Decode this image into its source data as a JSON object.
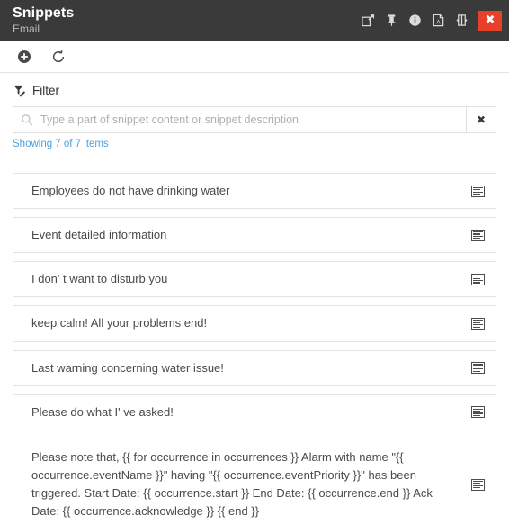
{
  "titlebar": {
    "title": "Snippets",
    "subtitle": "Email",
    "actions": [
      {
        "name": "popout-icon",
        "label": "Open in new window"
      },
      {
        "name": "pin-icon",
        "label": "Pin"
      },
      {
        "name": "info-icon",
        "label": "Info"
      },
      {
        "name": "pdf-icon",
        "label": "Export PDF"
      },
      {
        "name": "dock-icon",
        "label": "Dock panel"
      }
    ],
    "close_label": "✖"
  },
  "toolbar": {
    "add_label": "Add",
    "refresh_label": "Refresh"
  },
  "filter": {
    "label": "Filter",
    "search_value": "",
    "search_placeholder": "Type a part of snippet content or snippet description",
    "clear_label": "✖",
    "showing_text": "Showing 7 of 7 items"
  },
  "snippets": [
    {
      "text": "Employees do not have drinking water"
    },
    {
      "text": "Event detailed information"
    },
    {
      "text": "I don' t want to disturb you"
    },
    {
      "text": "keep calm! All your problems end!"
    },
    {
      "text": "Last warning concerning water issue!"
    },
    {
      "text": "Please do what I' ve asked!"
    },
    {
      "text": "Please note that, {{ for occurrence in occurrences }} Alarm with name \"{{ occurrence.eventName }}\" having \"{{ occurrence.eventPriority }}\" has been triggered. Start Date: {{ occurrence.start }} End Date: {{ occurrence.end }} Ack Date: {{ occurrence.acknowledge }} {{ end }}"
    }
  ],
  "colors": {
    "titlebar_bg": "#3a3a3a",
    "close_bg": "#e8412a",
    "link": "#4aa3df",
    "border": "#e3e3e3"
  }
}
